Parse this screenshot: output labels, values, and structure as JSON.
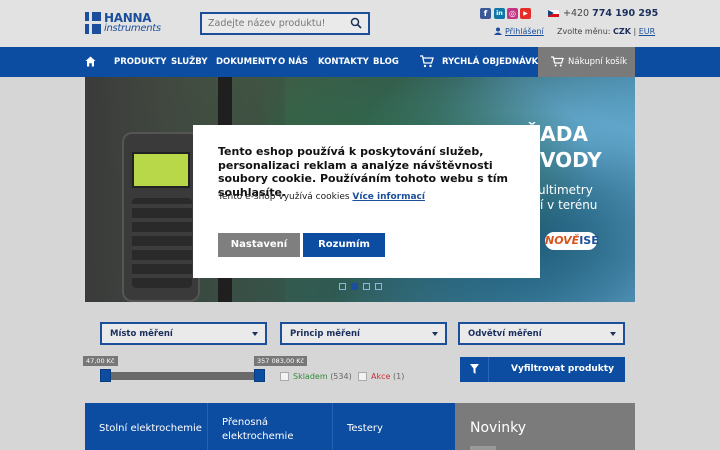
{
  "header": {
    "logo_line1": "HANNA",
    "logo_line2": "instruments",
    "search_placeholder": "Zadejte název produktu!",
    "phone_prefix": "+420",
    "phone_number": "774 190 295",
    "login_label": "Přihlášení",
    "currency_label": "Zvolte měnu:",
    "currency_active": "CZK",
    "currency_sep": "|",
    "currency_other": "EUR",
    "social": [
      {
        "name": "facebook-icon",
        "glyph": "f",
        "color": "#3b5998"
      },
      {
        "name": "linkedin-icon",
        "glyph": "in",
        "color": "#0e76a8"
      },
      {
        "name": "instagram-icon",
        "glyph": "◎",
        "color": "#c13584"
      },
      {
        "name": "youtube-icon",
        "glyph": "▶",
        "color": "#e52d27"
      }
    ]
  },
  "nav": {
    "items": [
      "PRODUKTY",
      "SLUŽBY",
      "DOKUMENTY",
      "O NÁS",
      "KONTAKTY",
      "BLOG"
    ],
    "quick_order": "RYCHLÁ OBJEDNÁVKA",
    "basket": "Nákupní košík"
  },
  "hero": {
    "line1": "ŘADA",
    "line2": "VODY",
    "line3": "ultimetry",
    "line4": "í v terénu",
    "badge_new": "NOVĚ",
    "badge_ise": "ISE",
    "slides": 4,
    "active_slide": 2
  },
  "cookie": {
    "message": "Tento eshop používá k poskytování služeb, personalizaci reklam a analýze návštěvnosti soubory cookie. Používáním tohoto webu s tím souhlasíte.",
    "info_text": "Tento e-shop využívá cookies",
    "info_link": "Více informací",
    "settings_button": "Nastavení",
    "accept_button": "Rozumím"
  },
  "filters": {
    "dropdowns": [
      "Místo měření",
      "Princip měření",
      "Odvětví měření"
    ],
    "price_min": "47,00 Kč",
    "price_max": "357 083,00 Kč",
    "stock_label": "Skladem",
    "stock_count": "(534)",
    "sale_label": "Akce",
    "sale_count": "(1)",
    "filter_button": "Vyfiltrovat produkty"
  },
  "categories": [
    "Stolní elektrochemie",
    "Přenosná elektrochemie",
    "Testery"
  ],
  "news_title": "Novinky",
  "colors": {
    "brand_blue": "#0d4da1",
    "stock_green": "#2e8b3a",
    "sale_red": "#c83232"
  }
}
